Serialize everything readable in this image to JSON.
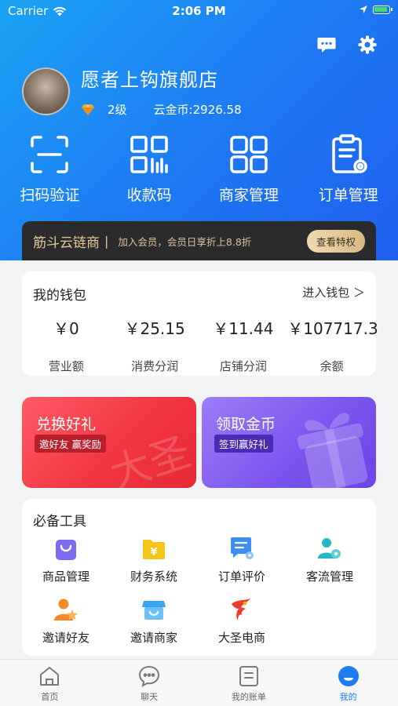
{
  "status_bar": {
    "carrier": "Carrier",
    "time": "2:06 PM"
  },
  "profile": {
    "shop_name": "愿者上钩旗舰店",
    "level": "2级",
    "coins": "云金币:2926.58"
  },
  "quick_actions": [
    {
      "label": "扫码验证",
      "icon": "scan-icon"
    },
    {
      "label": "收款码",
      "icon": "qr-code-icon"
    },
    {
      "label": "商家管理",
      "icon": "grid-icon"
    },
    {
      "label": "订单管理",
      "icon": "clipboard-icon"
    }
  ],
  "vip": {
    "brand": "筋斗云链商",
    "separator": "|",
    "desc": "加入会员，会员日享折上8.8折",
    "button": "查看特权"
  },
  "wallet": {
    "title": "我的钱包",
    "link": "进入钱包 ＞",
    "items": [
      {
        "value": "￥0",
        "label": "营业额"
      },
      {
        "value": "￥25.15",
        "label": "消费分润"
      },
      {
        "value": "￥11.44",
        "label": "店铺分润"
      },
      {
        "value": "￥107717.3",
        "label": "余额"
      }
    ]
  },
  "banners": [
    {
      "title": "兑换好礼",
      "tag": "邀好友 赢奖励",
      "deco": "大圣"
    },
    {
      "title": "领取金币",
      "tag": "签到赢好礼"
    }
  ],
  "tools": {
    "title": "必备工具",
    "items": [
      {
        "label": "商品管理",
        "icon": "shopping-bag-icon"
      },
      {
        "label": "财务系统",
        "icon": "finance-folder-icon"
      },
      {
        "label": "订单评价",
        "icon": "review-icon"
      },
      {
        "label": "客流管理",
        "icon": "customer-flow-icon"
      },
      {
        "label": "邀请好友",
        "icon": "invite-friend-icon"
      },
      {
        "label": "邀请商家",
        "icon": "invite-merchant-icon"
      },
      {
        "label": "大圣电商",
        "icon": "dasheng-logo-icon"
      }
    ]
  },
  "tabbar": [
    {
      "label": "首页",
      "icon": "home-icon",
      "active": false
    },
    {
      "label": "聊天",
      "icon": "chat-icon",
      "active": false
    },
    {
      "label": "我的账单",
      "icon": "bill-icon",
      "active": false
    },
    {
      "label": "我的",
      "icon": "profile-icon",
      "active": true
    }
  ],
  "colors": {
    "hero_blue": "#1e78f2",
    "accent_blue": "#1d7cf2",
    "vip_gold": "#e6c998",
    "banner_red": "#f0333f",
    "banner_purple": "#7b53ee"
  }
}
